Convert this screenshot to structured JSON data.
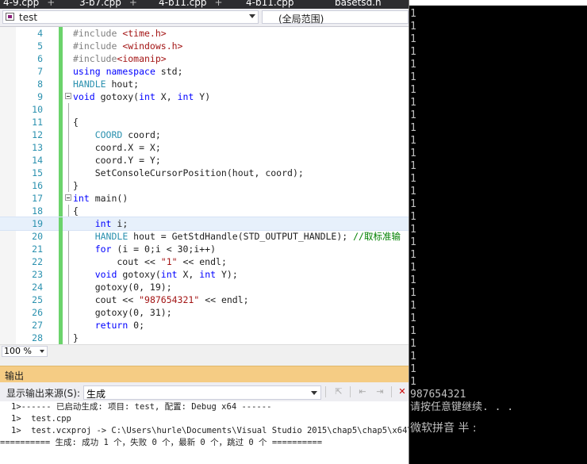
{
  "tabs": [
    {
      "label": "4-9.cpp"
    },
    {
      "label": "3-b7.cpp"
    },
    {
      "label": "4-b11.cpp"
    },
    {
      "label": "4-b11.cpp"
    },
    {
      "label": "basetsd.h"
    }
  ],
  "nav": {
    "project_combo": "test",
    "scope_combo": "(全局范围)"
  },
  "editor": {
    "lines": [
      {
        "num": "4",
        "code": "#include <time.h>"
      },
      {
        "num": "5",
        "code": "#include <windows.h>"
      },
      {
        "num": "6",
        "code": "#include<iomanip>"
      },
      {
        "num": "7",
        "code": "using namespace std;"
      },
      {
        "num": "8",
        "code": "HANDLE hout;"
      },
      {
        "num": "9",
        "code": "void gotoxy(int X, int Y)"
      },
      {
        "num": "10",
        "code": ""
      },
      {
        "num": "11",
        "code": "{"
      },
      {
        "num": "12",
        "code": "    COORD coord;"
      },
      {
        "num": "13",
        "code": "    coord.X = X;"
      },
      {
        "num": "14",
        "code": "    coord.Y = Y;"
      },
      {
        "num": "15",
        "code": "    SetConsoleCursorPosition(hout, coord);"
      },
      {
        "num": "16",
        "code": "}"
      },
      {
        "num": "17",
        "code": "int main()"
      },
      {
        "num": "18",
        "code": "{"
      },
      {
        "num": "19",
        "code": "    int i;"
      },
      {
        "num": "20",
        "code": "    HANDLE hout = GetStdHandle(STD_OUTPUT_HANDLE); //取标准输"
      },
      {
        "num": "21",
        "code": "    for (i = 0;i < 30;i++)"
      },
      {
        "num": "22",
        "code": "        cout << \"1\" << endl;"
      },
      {
        "num": "23",
        "code": "    void gotoxy(int X, int Y);"
      },
      {
        "num": "24",
        "code": "    gotoxy(0, 19);"
      },
      {
        "num": "25",
        "code": "    cout << \"987654321\" << endl;"
      },
      {
        "num": "26",
        "code": "    gotoxy(0, 31);"
      },
      {
        "num": "27",
        "code": "    return 0;"
      },
      {
        "num": "28",
        "code": "}"
      }
    ],
    "zoom": "100 %"
  },
  "output": {
    "title": "输出",
    "source_label": "显示输出来源(S):",
    "source_value": "生成",
    "lines": [
      "1>------ 已启动生成: 项目: test, 配置: Debug x64 ------",
      "1>  test.cpp",
      "1>  test.vcxproj -> C:\\Users\\hurle\\Documents\\Visual Studio 2015\\chap5\\chap5\\x64\\Debu",
      "========== 生成: 成功 1 个，失败 0 个，最新 0 个，跳过 0 个 =========="
    ]
  },
  "console": {
    "lines": [
      "1",
      "1",
      "1",
      "1",
      "1",
      "1",
      "1",
      "1",
      "1",
      "1",
      "1",
      "1",
      "1",
      "1",
      "1",
      "1",
      "1",
      "1",
      "1",
      "1",
      "1",
      "1",
      "1",
      "1",
      "1",
      "1",
      "1",
      "1",
      "1",
      "1",
      "987654321",
      "请按任意键继续. . ."
    ],
    "ime_status": "微软拼音 半 :"
  }
}
